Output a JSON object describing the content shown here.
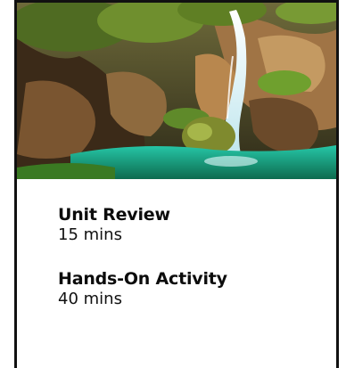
{
  "hero_image": {
    "icon": "waterfall-photo",
    "colors": {
      "rock_dark": "#3b2a18",
      "rock_light": "#b8874e",
      "foliage": "#5f8a2a",
      "water": "#cfe9ef",
      "pool": "#1fb59a"
    }
  },
  "activities": [
    {
      "title": "Unit Review",
      "duration": "15 mins"
    },
    {
      "title": "Hands-On Activity",
      "duration": "40 mins"
    }
  ]
}
